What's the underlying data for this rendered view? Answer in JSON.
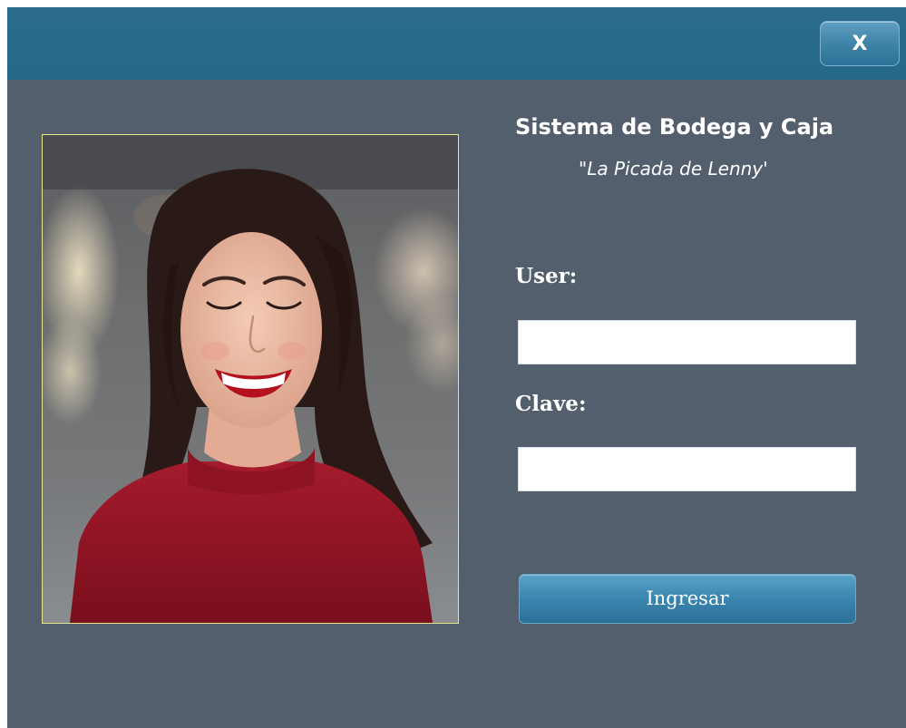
{
  "window": {
    "close_label": "X"
  },
  "header": {
    "title": "Sistema de Bodega y Caja",
    "subtitle": "\"La Picada de Lenny'"
  },
  "form": {
    "user_label": "User:",
    "user_value": "",
    "password_label": "Clave:",
    "password_value": "",
    "submit_label": "Ingresar"
  },
  "colors": {
    "background": "#535f6d",
    "titlebar": "#276a8a",
    "button_accent": "#3a86af",
    "photo_border": "#e6e78b"
  },
  "icons": {
    "close": "close-icon"
  }
}
